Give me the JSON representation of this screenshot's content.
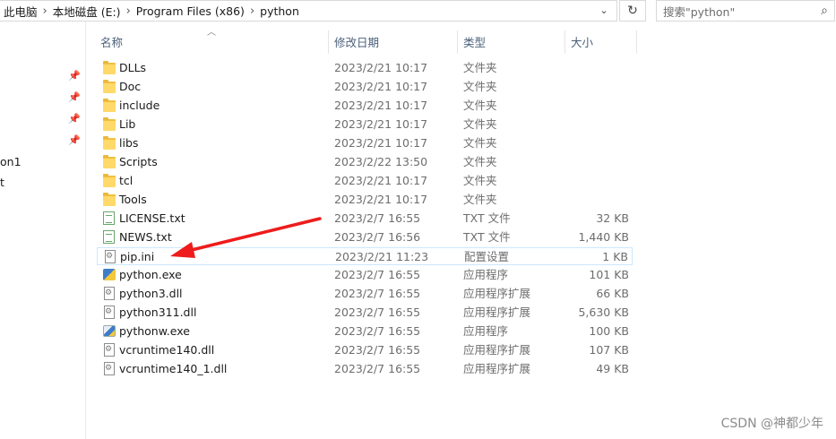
{
  "address": {
    "crumbs": [
      "此电脑",
      "本地磁盘 (E:)",
      "Program Files (x86)",
      "python"
    ],
    "separator": "›",
    "dropdown_icon": "chevron-down-icon",
    "refresh_icon": "refresh-icon"
  },
  "search": {
    "placeholder": "搜索\"python\"",
    "icon": "search-icon"
  },
  "nav": {
    "fragments": [
      "on1",
      "t"
    ]
  },
  "columns": {
    "name": "名称",
    "date": "修改日期",
    "type": "类型",
    "size": "大小"
  },
  "files": [
    {
      "name": "DLLs",
      "date": "2023/2/21 10:17",
      "type": "文件夹",
      "size": "",
      "icon": "folder-icon"
    },
    {
      "name": "Doc",
      "date": "2023/2/21 10:17",
      "type": "文件夹",
      "size": "",
      "icon": "folder-icon"
    },
    {
      "name": "include",
      "date": "2023/2/21 10:17",
      "type": "文件夹",
      "size": "",
      "icon": "folder-icon"
    },
    {
      "name": "Lib",
      "date": "2023/2/21 10:17",
      "type": "文件夹",
      "size": "",
      "icon": "folder-icon"
    },
    {
      "name": "libs",
      "date": "2023/2/21 10:17",
      "type": "文件夹",
      "size": "",
      "icon": "folder-icon"
    },
    {
      "name": "Scripts",
      "date": "2023/2/22 13:50",
      "type": "文件夹",
      "size": "",
      "icon": "folder-icon"
    },
    {
      "name": "tcl",
      "date": "2023/2/21 10:17",
      "type": "文件夹",
      "size": "",
      "icon": "folder-icon"
    },
    {
      "name": "Tools",
      "date": "2023/2/21 10:17",
      "type": "文件夹",
      "size": "",
      "icon": "folder-icon"
    },
    {
      "name": "LICENSE.txt",
      "date": "2023/2/7 16:55",
      "type": "TXT 文件",
      "size": "32 KB",
      "icon": "text-file-icon"
    },
    {
      "name": "NEWS.txt",
      "date": "2023/2/7 16:56",
      "type": "TXT 文件",
      "size": "1,440 KB",
      "icon": "text-file-icon"
    },
    {
      "name": "pip.ini",
      "date": "2023/2/21 11:23",
      "type": "配置设置",
      "size": "1 KB",
      "icon": "config-file-icon",
      "selected": true
    },
    {
      "name": "python.exe",
      "date": "2023/2/7 16:55",
      "type": "应用程序",
      "size": "101 KB",
      "icon": "python-exe-icon"
    },
    {
      "name": "python3.dll",
      "date": "2023/2/7 16:55",
      "type": "应用程序扩展",
      "size": "66 KB",
      "icon": "dll-file-icon"
    },
    {
      "name": "python311.dll",
      "date": "2023/2/7 16:55",
      "type": "应用程序扩展",
      "size": "5,630 KB",
      "icon": "dll-file-icon"
    },
    {
      "name": "pythonw.exe",
      "date": "2023/2/7 16:55",
      "type": "应用程序",
      "size": "100 KB",
      "icon": "pythonw-exe-icon"
    },
    {
      "name": "vcruntime140.dll",
      "date": "2023/2/7 16:55",
      "type": "应用程序扩展",
      "size": "107 KB",
      "icon": "dll-file-icon"
    },
    {
      "name": "vcruntime140_1.dll",
      "date": "2023/2/7 16:55",
      "type": "应用程序扩展",
      "size": "49 KB",
      "icon": "dll-file-icon"
    }
  ],
  "annotation": {
    "color": "#ee1c1c",
    "points_to": "pip.ini"
  },
  "watermark": "CSDN @神都少年"
}
